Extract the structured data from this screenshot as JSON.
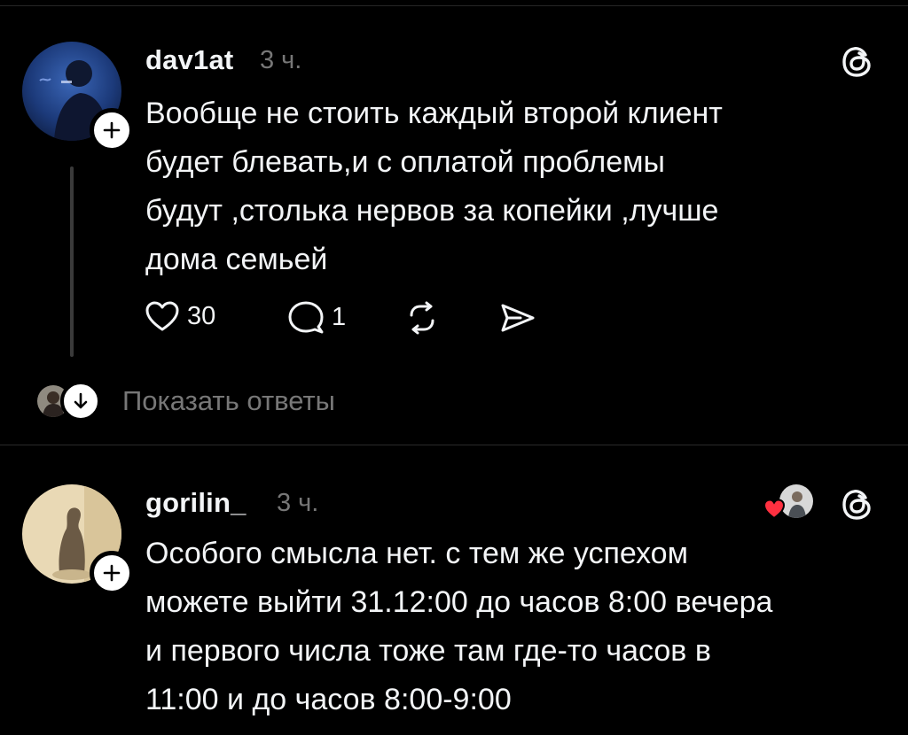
{
  "posts": [
    {
      "username": "dav1at",
      "time": "3 ч.",
      "text": "Вообще не стоить каждый второй клиент\nбудет блевать,и с оплатой проблемы\nбудут ,столька нервов за копейки ,лучше\nдома семьей",
      "likes": "30",
      "comments": "1",
      "show_replies": "Показать ответы"
    },
    {
      "username": "gorilin_",
      "time": "3 ч.",
      "text": "Особого смысла нет. с тем же успехом\nможете выйти 31.12:00 до часов 8:00 вечера\nи первого числа тоже там где-то часов в\n11:00 и до часов 8:00-9:00"
    }
  ],
  "icons": {
    "threads": "threads-icon",
    "follow": "plus-icon",
    "like": "heart-icon",
    "comment": "comment-icon",
    "repost": "repost-icon",
    "share": "share-icon",
    "expand": "arrow-down-icon",
    "liked_by_author": "heart-badge-icon"
  },
  "colors": {
    "background": "#000000",
    "text": "#f3f5f7",
    "muted": "#777777",
    "divider": "#2a2a2a",
    "heart": "#ff3040"
  }
}
